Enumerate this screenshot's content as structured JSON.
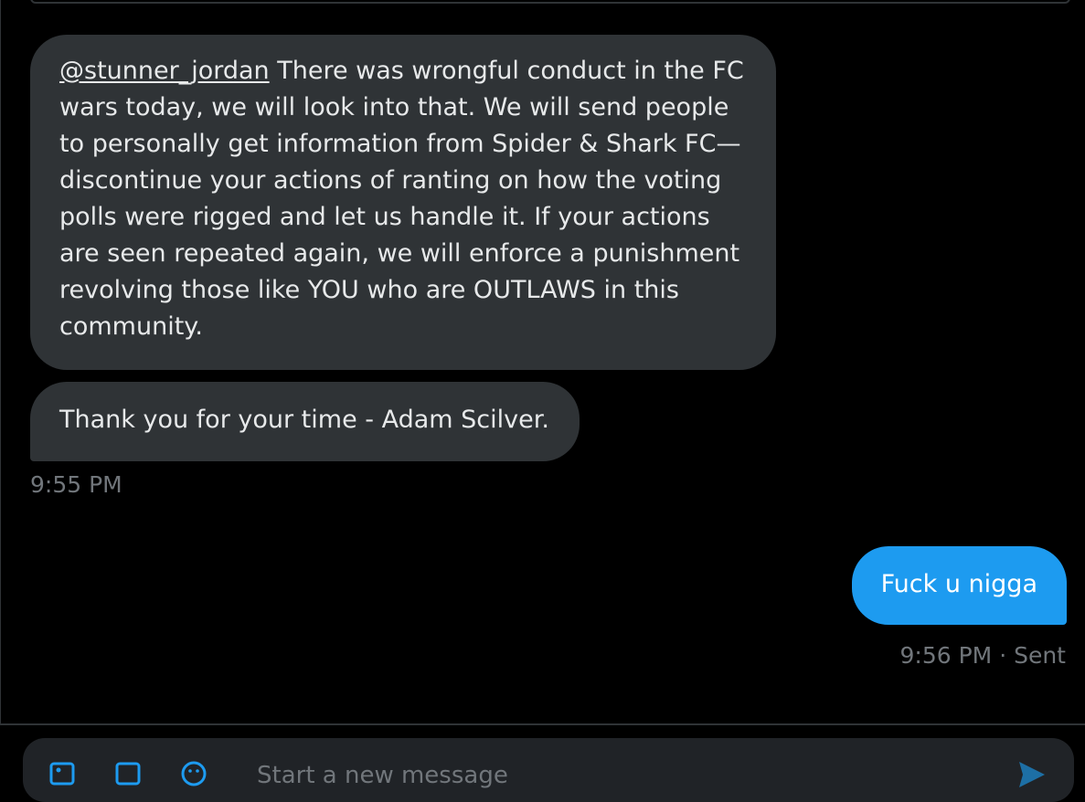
{
  "messages": {
    "incoming": {
      "mention": "@stunner_jordan",
      "body": " There was wrongful conduct in the FC wars today, we will look into that. We will send people to personally get information from Spider & Shark FC—discontinue your actions of ranting on how the voting polls were rigged and let us handle it. If your actions are seen repeated again, we will enforce a punishment revolving those like YOU who are OUTLAWS in this community.",
      "second": "Thank you for your time - Adam Scilver.",
      "time": "9:55 PM"
    },
    "outgoing": {
      "text": "Fuck u nigga",
      "status": "9:56 PM · Sent"
    }
  },
  "composer": {
    "placeholder": "Start a new message",
    "icons": [
      "image-icon",
      "gif-icon",
      "emoji-icon",
      "send-icon"
    ]
  },
  "colors": {
    "background": "#000000",
    "incoming_bubble": "#2f3336",
    "outgoing_bubble": "#1d9bf0",
    "muted_text": "#71767b"
  }
}
